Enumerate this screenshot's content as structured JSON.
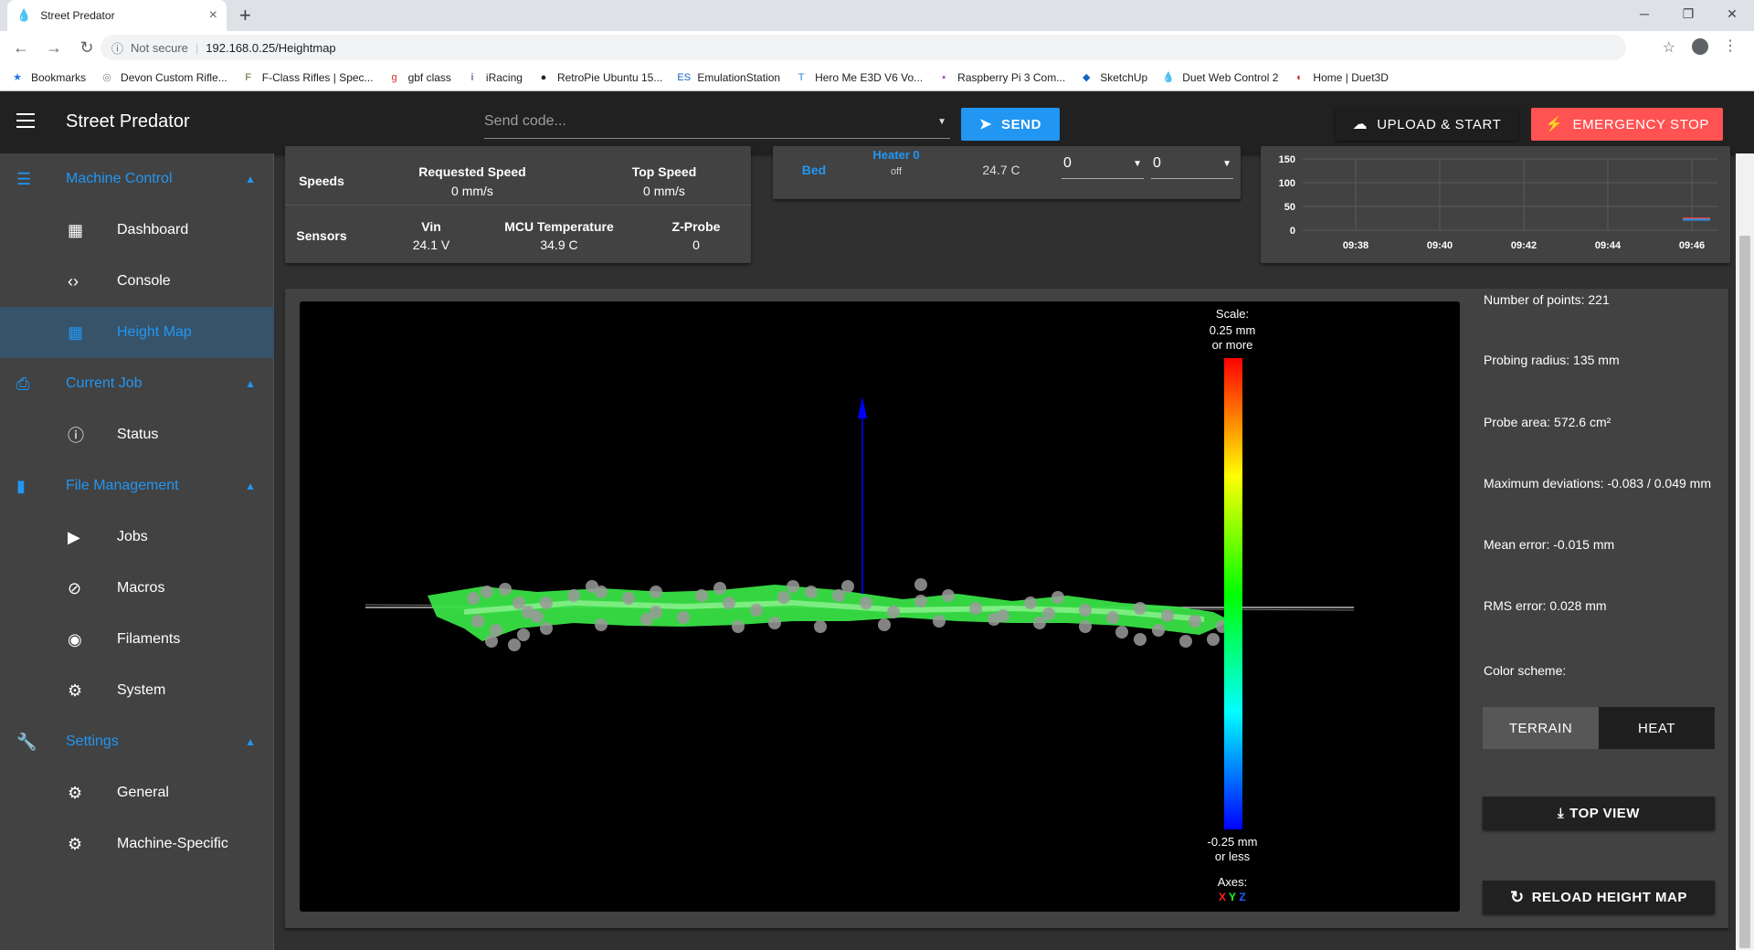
{
  "browser": {
    "tab_title": "Street Predator",
    "not_secure": "Not secure",
    "url": "192.168.0.25/Heightmap",
    "bookmarks": [
      {
        "label": "Bookmarks",
        "icon": "star-icon",
        "color": "#1a73e8"
      },
      {
        "label": "Devon Custom Rifle...",
        "icon": "globe-icon",
        "color": "#888888"
      },
      {
        "label": "F-Class Rifles | Spec...",
        "icon": "f-icon",
        "color": "#556b2f"
      },
      {
        "label": "gbf class",
        "icon": "gbf-icon",
        "color": "#d32f2f"
      },
      {
        "label": "iRacing",
        "icon": "iracing-icon",
        "color": "#1a237e"
      },
      {
        "label": "RetroPie Ubuntu 15...",
        "icon": "github-icon",
        "color": "#222222"
      },
      {
        "label": "EmulationStation",
        "icon": "es-icon",
        "color": "#1565c0"
      },
      {
        "label": "Hero Me E3D V6 Vo...",
        "icon": "thingiverse-icon",
        "color": "#1e88e5"
      },
      {
        "label": "Raspberry Pi 3 Com...",
        "icon": "rpi-icon",
        "color": "#ab47bc"
      },
      {
        "label": "SketchUp",
        "icon": "sketchup-icon",
        "color": "#1565c0"
      },
      {
        "label": "Duet Web Control 2",
        "icon": "duet-icon",
        "color": "#1565c0"
      },
      {
        "label": "Home | Duet3D",
        "icon": "duet3d-icon",
        "color": "#c62828"
      }
    ]
  },
  "appbar": {
    "title": "Street Predator",
    "send_placeholder": "Send code...",
    "send_label": "SEND",
    "upload_label": "UPLOAD & START",
    "stop_label": "EMERGENCY STOP"
  },
  "sidebar": {
    "groups": [
      {
        "label": "Machine Control",
        "icon": "tune-icon",
        "items": [
          {
            "label": "Dashboard",
            "icon": "dashboard-icon"
          },
          {
            "label": "Console",
            "icon": "code-icon"
          },
          {
            "label": "Height Map",
            "icon": "grid-icon",
            "active": true
          }
        ]
      },
      {
        "label": "Current Job",
        "icon": "printer-icon",
        "items": [
          {
            "label": "Status",
            "icon": "info-icon"
          }
        ]
      },
      {
        "label": "File Management",
        "icon": "sd-card-icon",
        "items": [
          {
            "label": "Jobs",
            "icon": "play-icon"
          },
          {
            "label": "Macros",
            "icon": "macro-icon"
          },
          {
            "label": "Filaments",
            "icon": "radio-icon"
          },
          {
            "label": "System",
            "icon": "gear-icon"
          }
        ]
      },
      {
        "label": "Settings",
        "icon": "wrench-icon",
        "items": [
          {
            "label": "General",
            "icon": "gear-icon"
          },
          {
            "label": "Machine-Specific",
            "icon": "gears-icon"
          }
        ]
      }
    ]
  },
  "status_card": {
    "speeds_label": "Speeds",
    "requested_speed_label": "Requested Speed",
    "requested_speed": "0 mm/s",
    "top_speed_label": "Top Speed",
    "top_speed": "0 mm/s",
    "sensors_label": "Sensors",
    "vin_label": "Vin",
    "vin": "24.1 V",
    "mcu_label": "MCU Temperature",
    "mcu": "34.9 C",
    "zprobe_label": "Z-Probe",
    "zprobe": "0"
  },
  "tools_card": {
    "bed_label": "Bed",
    "heater_label": "Heater 0",
    "heater_state": "off",
    "current_temp": "24.7 C",
    "active_value": "0",
    "standby_value": "0"
  },
  "temp_chart": {
    "y_ticks": [
      "150",
      "100",
      "50",
      "0"
    ],
    "x_ticks": [
      "09:38",
      "09:40",
      "09:42",
      "09:44",
      "09:46"
    ]
  },
  "chart_data": {
    "type": "line",
    "title": "",
    "xlabel": "",
    "ylabel": "",
    "x": [
      "09:38",
      "09:40",
      "09:42",
      "09:44",
      "09:46"
    ],
    "ylim": [
      0,
      150
    ],
    "series": [
      {
        "values": [
          null,
          null,
          null,
          null,
          24.7
        ],
        "color": "#f44336"
      },
      {
        "values": [
          null,
          null,
          null,
          null,
          22
        ],
        "color": "#2196f3"
      }
    ]
  },
  "heightmap": {
    "scale_label": "Scale:",
    "scale_max": "0.25 mm",
    "scale_max_sub": "or more",
    "scale_min": "-0.25 mm",
    "scale_min_sub": "or less",
    "axes_label": "Axes:",
    "axis_x": "X",
    "axis_y": "Y",
    "axis_z": "Z",
    "num_points": "Number of points: 221",
    "probing_radius": "Probing radius: 135 mm",
    "probe_area": "Probe area: 572.6 cm²",
    "max_dev": "Maximum deviations: -0.083 / 0.049 mm",
    "mean_error": "Mean error: -0.015 mm",
    "rms_error": "RMS error: 0.028 mm",
    "color_scheme_label": "Color scheme:",
    "terrain_label": "TERRAIN",
    "heat_label": "HEAT",
    "top_view_label": "TOP VIEW",
    "reload_label": "RELOAD HEIGHT MAP"
  }
}
